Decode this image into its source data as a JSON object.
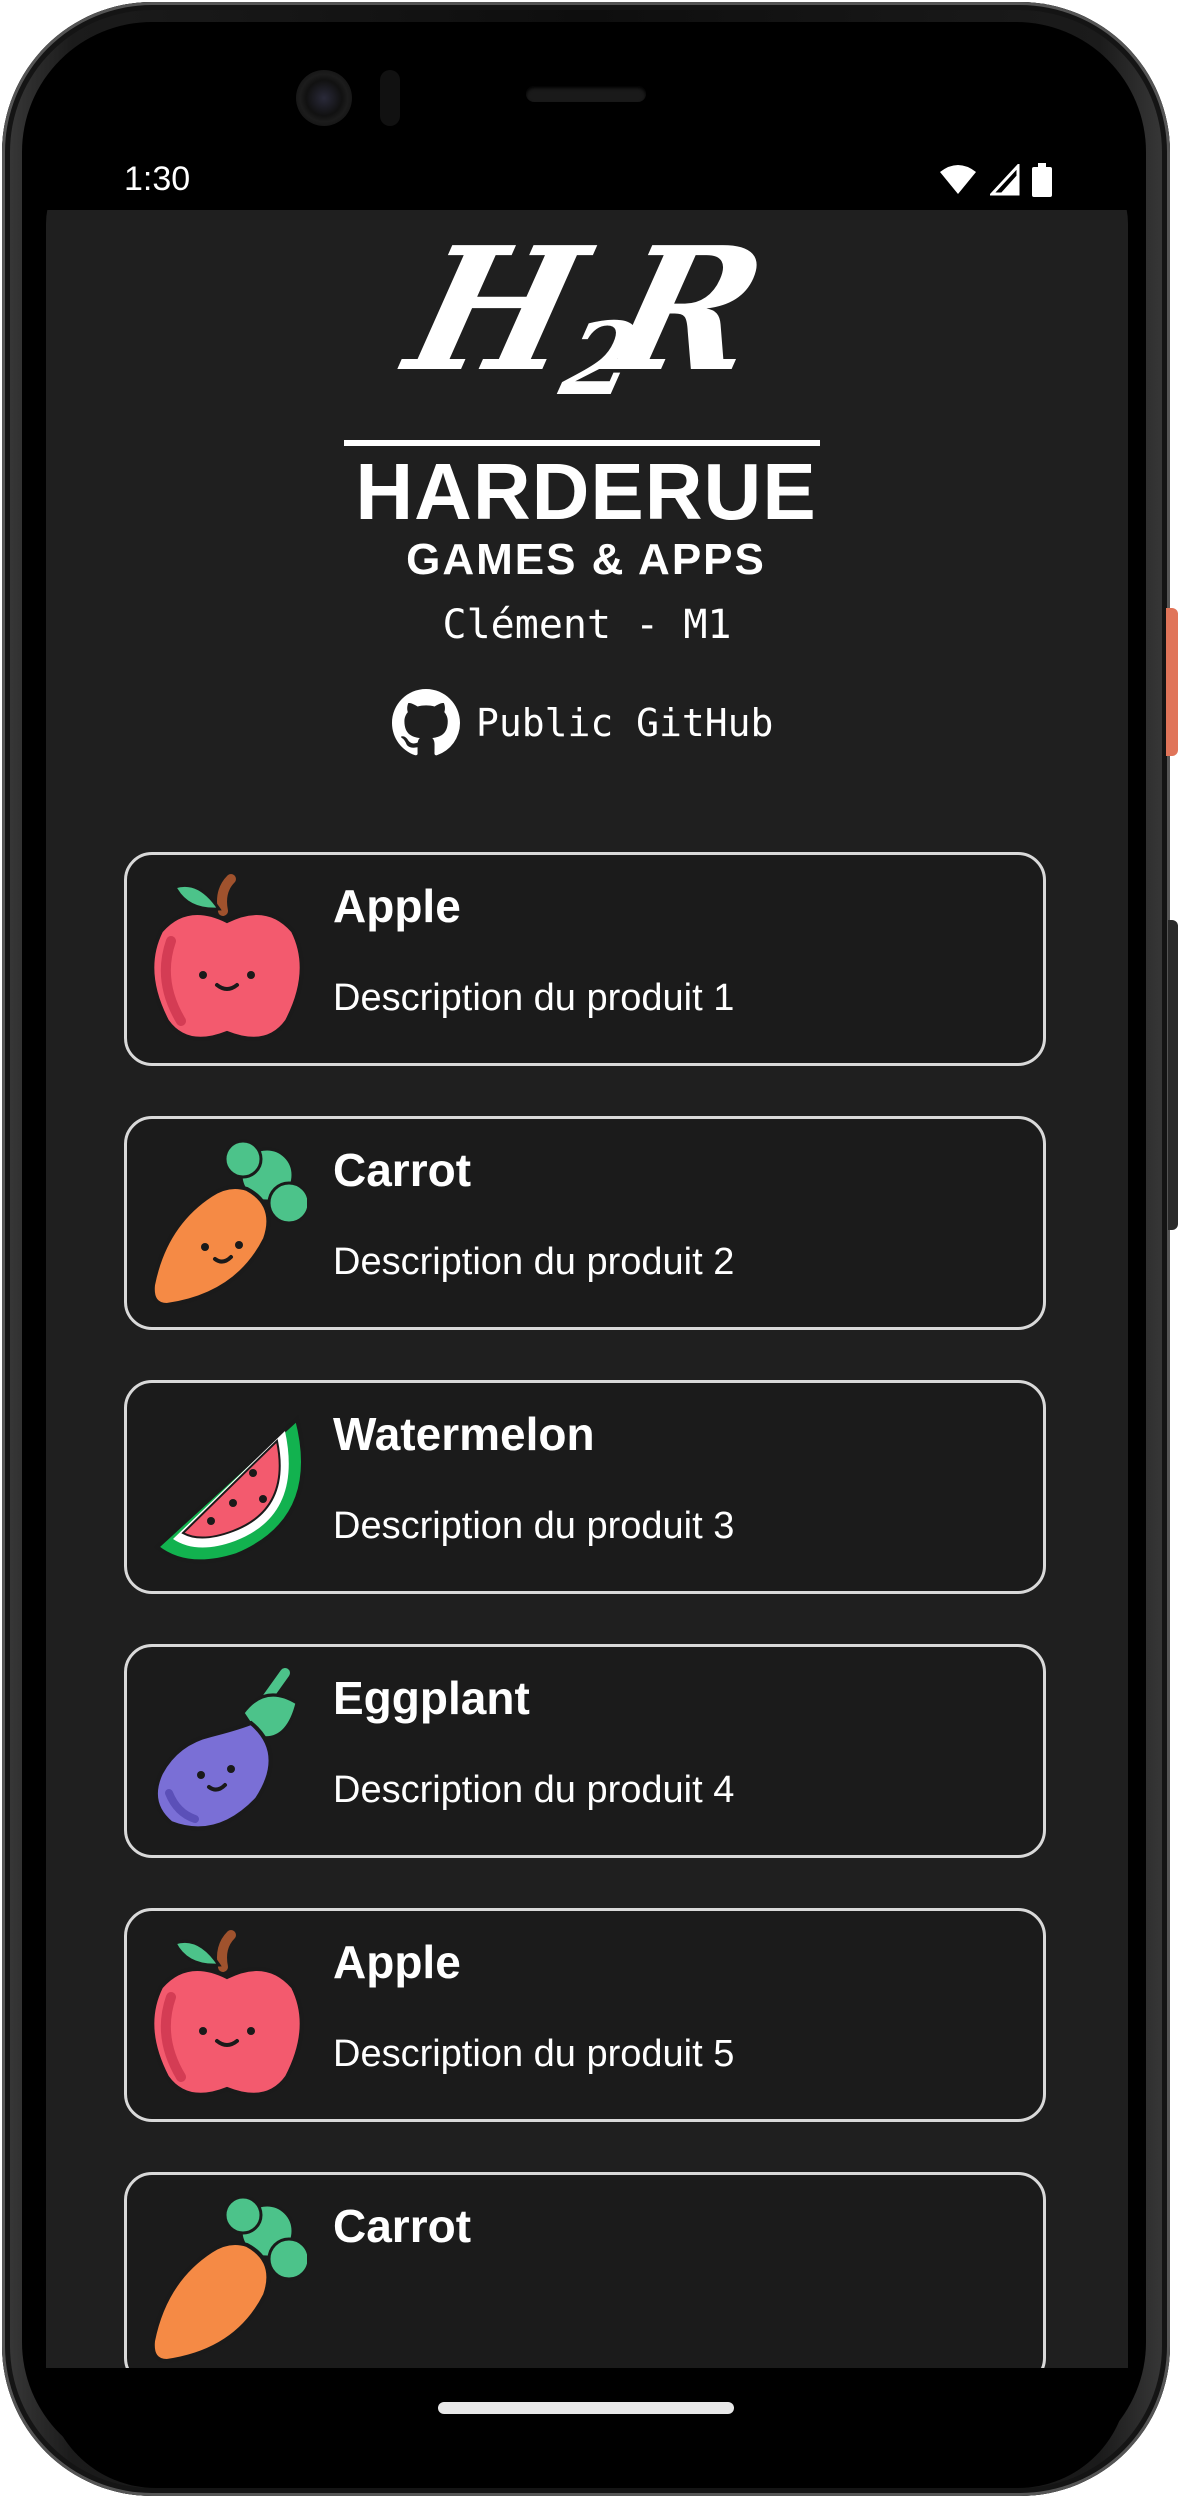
{
  "status_bar": {
    "time": "1:30",
    "icons": [
      "wifi-icon",
      "cellular-signal-icon",
      "battery-icon"
    ]
  },
  "header": {
    "logo_monogram": "H2R",
    "logo_title": "HARDERUE",
    "logo_subtitle": "GAMES & APPS",
    "author": "Clément - M1",
    "github_label": "Public GitHub",
    "github_icon": "github-icon"
  },
  "products": [
    {
      "name": "Apple",
      "description": "Description du produit 1",
      "icon": "apple-icon"
    },
    {
      "name": "Carrot",
      "description": "Description du produit 2",
      "icon": "carrot-icon"
    },
    {
      "name": "Watermelon",
      "description": "Description du produit 3",
      "icon": "watermelon-icon"
    },
    {
      "name": "Eggplant",
      "description": "Description du produit 4",
      "icon": "eggplant-icon"
    },
    {
      "name": "Apple",
      "description": "Description du produit 5",
      "icon": "apple-icon"
    },
    {
      "name": "Carrot",
      "description": "",
      "icon": "carrot-icon"
    }
  ],
  "colors": {
    "background": "#1f1f1f",
    "card_border": "#d9d9d9",
    "text": "#ffffff",
    "power_button": "#e07459"
  }
}
